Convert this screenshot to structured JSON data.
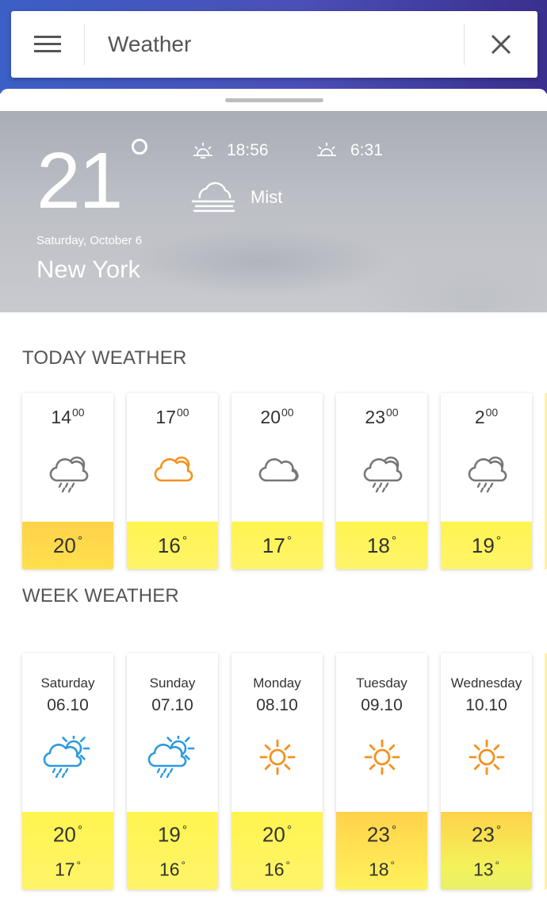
{
  "search": {
    "value": "Weather"
  },
  "hero": {
    "temperature": "21",
    "date": "Saturday, October 6",
    "city": "New York",
    "sunset": "18:56",
    "sunrise": "6:31",
    "condition": "Mist"
  },
  "today": {
    "title": "TODAY WEATHER",
    "hours": [
      {
        "hour": "14",
        "min": "00",
        "temp": "20",
        "icon": "rain-cloud-icon"
      },
      {
        "hour": "17",
        "min": "00",
        "temp": "16",
        "icon": "cloud-icon-orange"
      },
      {
        "hour": "20",
        "min": "00",
        "temp": "17",
        "icon": "cloud-icon"
      },
      {
        "hour": "23",
        "min": "00",
        "temp": "18",
        "icon": "rain-cloud-icon"
      },
      {
        "hour": "2",
        "min": "00",
        "temp": "19",
        "icon": "rain-cloud-icon"
      }
    ]
  },
  "week": {
    "title": "WEEK WEATHER",
    "days": [
      {
        "day": "Saturday",
        "date": "06.10",
        "high": "20",
        "low": "17",
        "icon": "sun-rain-icon"
      },
      {
        "day": "Sunday",
        "date": "07.10",
        "high": "19",
        "low": "16",
        "icon": "sun-rain-icon"
      },
      {
        "day": "Monday",
        "date": "08.10",
        "high": "20",
        "low": "16",
        "icon": "sun-icon"
      },
      {
        "day": "Tuesday",
        "date": "09.10",
        "high": "23",
        "low": "18",
        "icon": "sun-icon"
      },
      {
        "day": "Wednesday",
        "date": "10.10",
        "high": "23",
        "low": "13",
        "icon": "sun-icon"
      }
    ]
  },
  "colors": {
    "band_yellow": "#fff44f",
    "band_orange": "#ffd24a",
    "sun_orange": "#f5911e",
    "rain_blue": "#2c9be0",
    "icon_gray": "#777777"
  }
}
